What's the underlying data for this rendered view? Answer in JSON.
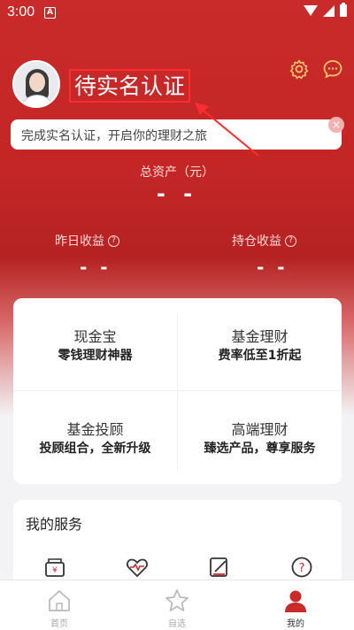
{
  "status_bar": {
    "time": "3:00",
    "notification_icon": "A"
  },
  "profile": {
    "verify_title": "待实名认证",
    "avatar_icon": "avatar"
  },
  "header_icons": {
    "settings": "settings-icon",
    "messages": "chat-icon"
  },
  "verify_banner": {
    "text": "完成实名认证，开启你的理财之旅",
    "close_label": "×"
  },
  "assets": {
    "total_label": "总资产（元）",
    "total_value": "- -",
    "yesterday_label": "昨日收益",
    "yesterday_value": "- -",
    "holding_label": "持仓收益",
    "holding_value": "- -",
    "help_glyph": "?"
  },
  "products": [
    {
      "name": "现金宝",
      "desc": "零钱理财神器"
    },
    {
      "name": "基金理财",
      "desc": "费率低至1折起"
    },
    {
      "name": "基金投顾",
      "desc": "投顾组合，全新升级"
    },
    {
      "name": "高端理财",
      "desc": "臻选产品，尊享服务"
    }
  ],
  "services": {
    "title": "我的服务"
  },
  "bottom_nav": [
    {
      "label": "首页",
      "icon": "home-icon"
    },
    {
      "label": "自选",
      "icon": "star-icon"
    },
    {
      "label": "我的",
      "icon": "user-icon",
      "active": true
    }
  ],
  "colors": {
    "brand_red": "#c92a2a",
    "annotation_red": "#ff2d2d"
  }
}
